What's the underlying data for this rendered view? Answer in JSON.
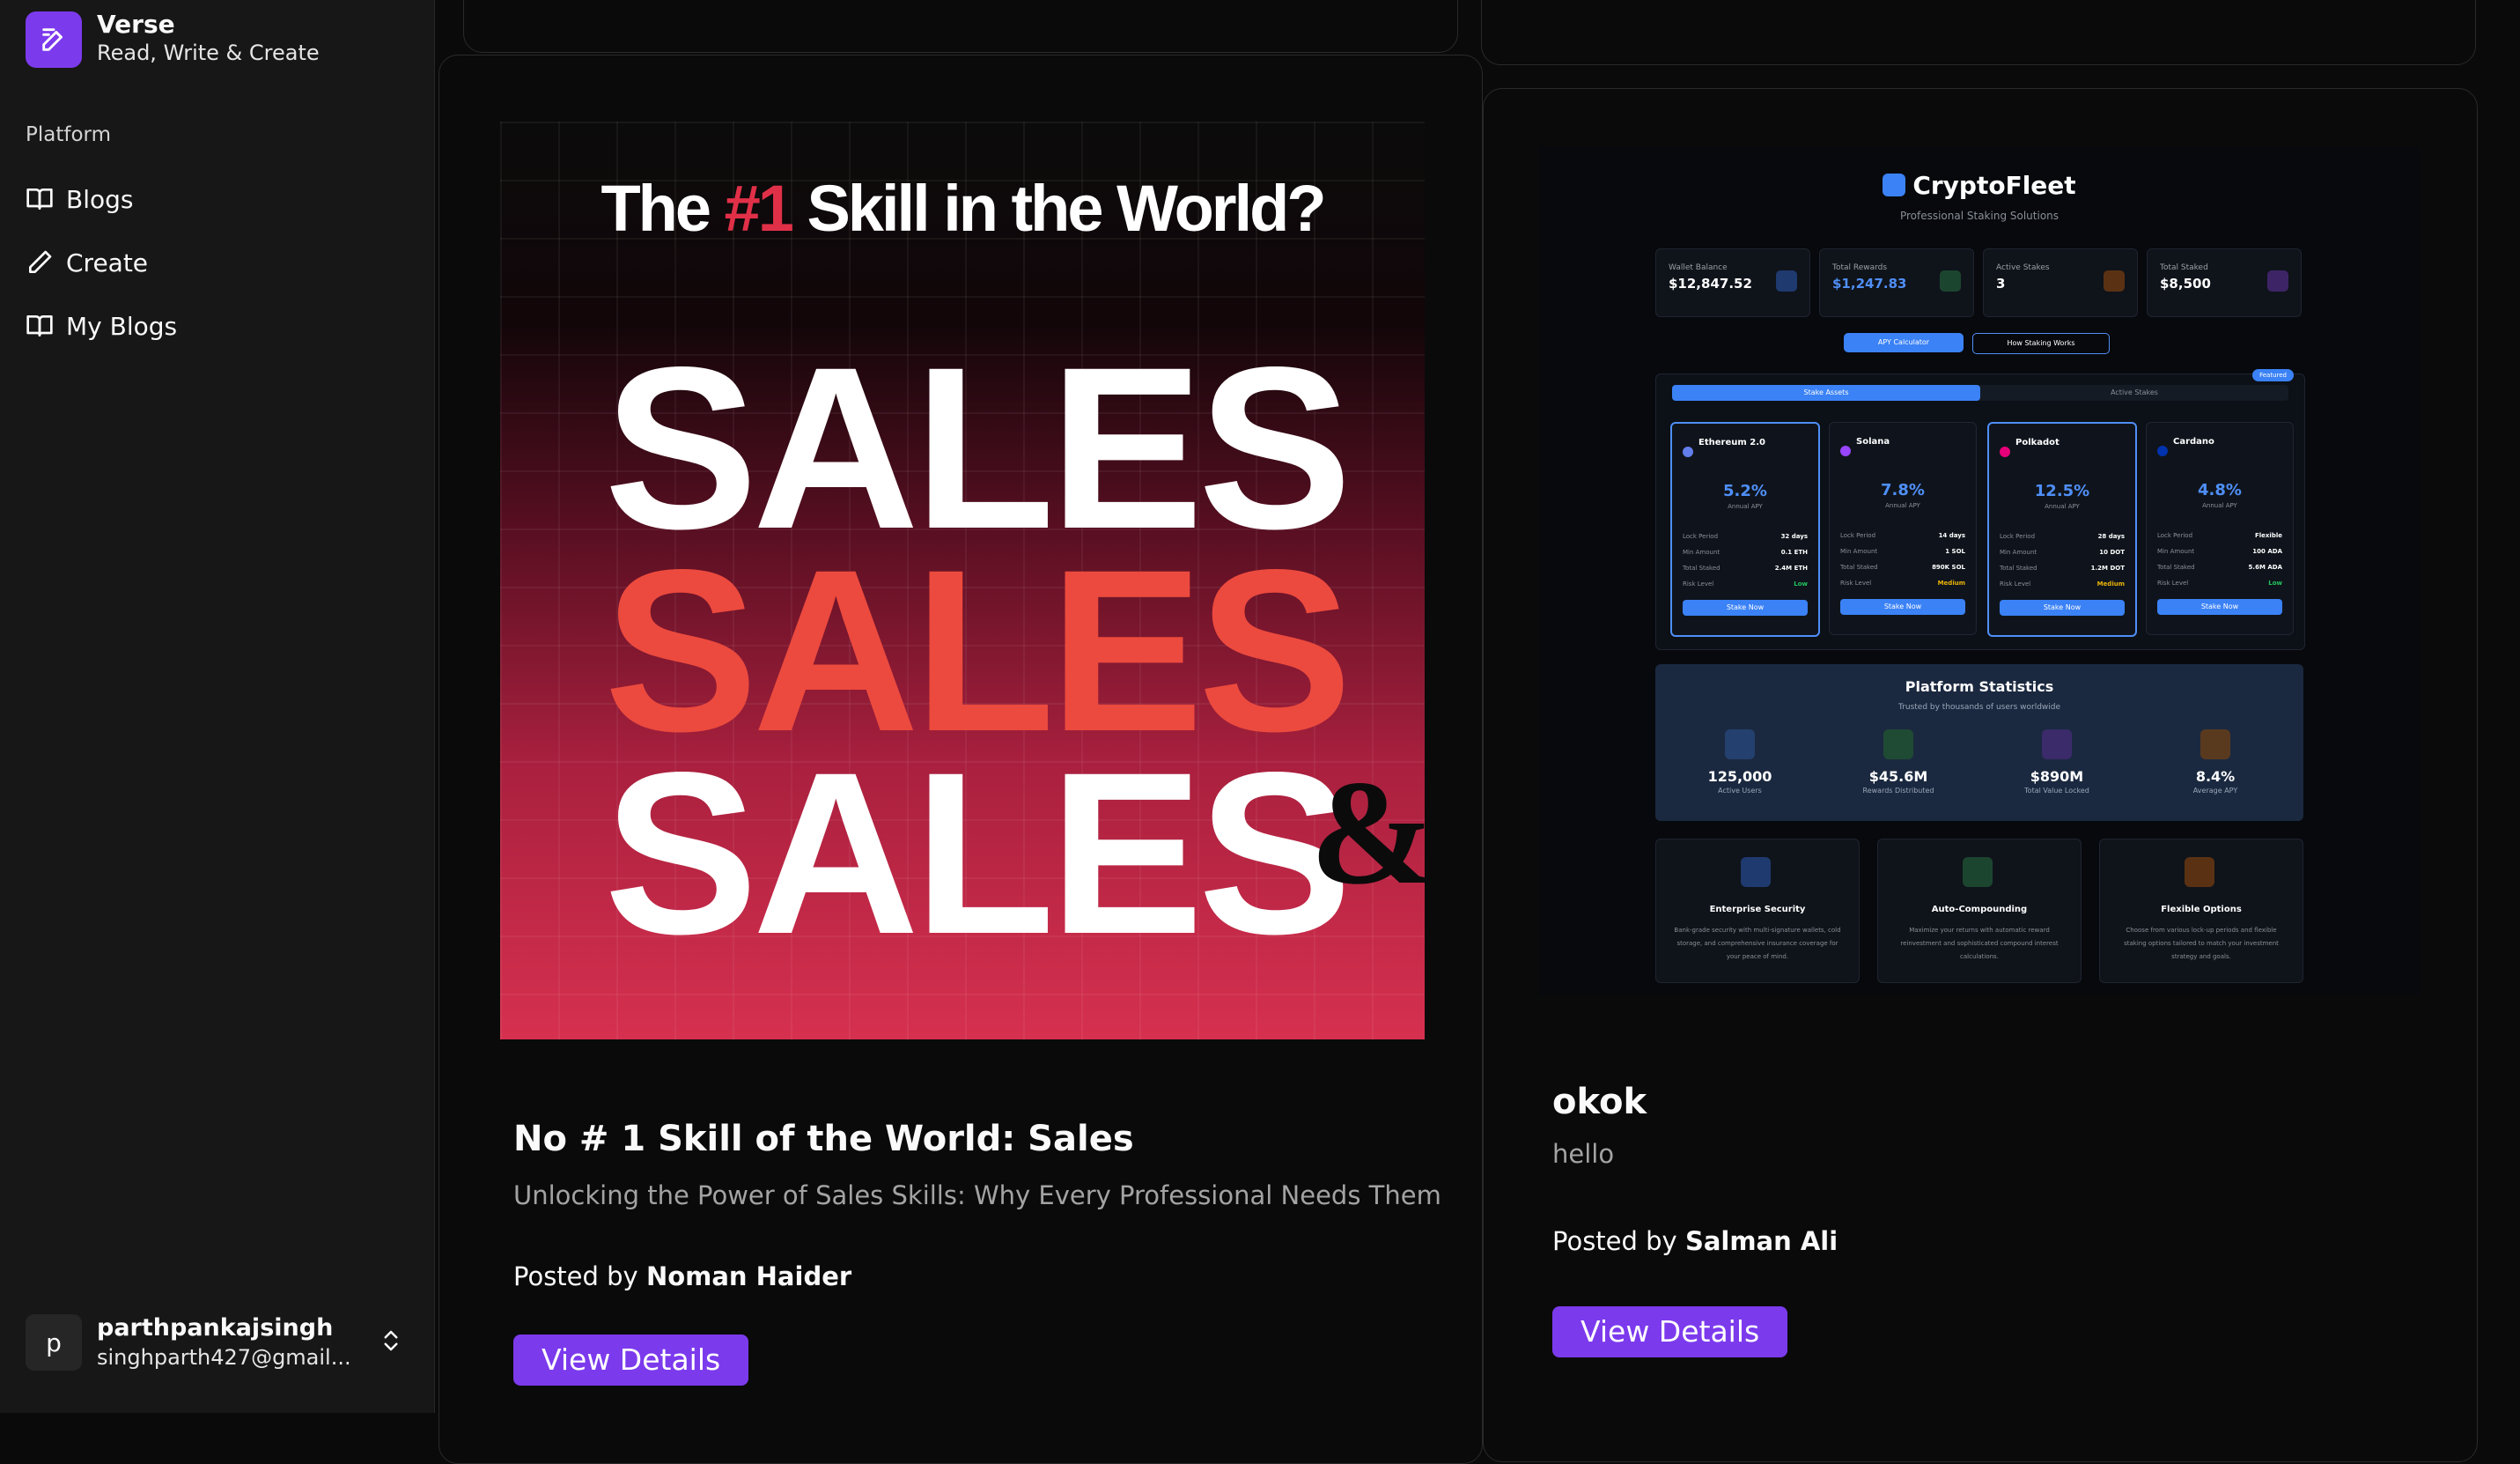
{
  "brand": {
    "name": "Verse",
    "tagline": "Read, Write & Create",
    "accent": "#7c3aed"
  },
  "sidebar": {
    "section_label": "Platform",
    "items": [
      {
        "label": "Blogs",
        "icon": "book-icon"
      },
      {
        "label": "Create",
        "icon": "pencil-icon"
      },
      {
        "label": "My Blogs",
        "icon": "book-icon"
      }
    ]
  },
  "user": {
    "initial": "p",
    "name": "parthpankajsingh",
    "email": "singhparth427@gmail...."
  },
  "posts": [
    {
      "title": "No # 1 Skill of the World: Sales",
      "description": "Unlocking the Power of Sales Skills: Why Every Professional Needs Them",
      "posted_by_prefix": "Posted by",
      "author": "Noman Haider",
      "button": "View Details",
      "image": {
        "headline_pre": "The",
        "headline_hl": "#1",
        "headline_post": "Skill in the World?",
        "words": [
          "SALES",
          "SALES",
          "SALES"
        ],
        "amp": "&"
      }
    },
    {
      "title": "okok",
      "description": "hello",
      "posted_by_prefix": "Posted by",
      "author": "Salman Ali",
      "button": "View Details",
      "image": {
        "brand": "CryptoFleet",
        "subtitle": "Professional Staking Solutions",
        "stats": [
          {
            "label": "Wallet Balance",
            "value": "$12,847.52"
          },
          {
            "label": "Total Rewards",
            "value": "$1,247.83"
          },
          {
            "label": "Active Stakes",
            "value": "3"
          },
          {
            "label": "Total Staked",
            "value": "$8,500"
          }
        ],
        "buttons": [
          "APY Calculator",
          "How Staking Works"
        ],
        "tabs": [
          "Stake Assets",
          "Active Stakes"
        ],
        "featured": "Featured",
        "assets": [
          {
            "name": "Ethereum 2.0",
            "apy": "5.2%",
            "lock": "32 days",
            "min": "0.1 ETH",
            "staked": "2.4M ETH",
            "risk": "Low"
          },
          {
            "name": "Solana",
            "apy": "7.8%",
            "lock": "14 days",
            "min": "1 SOL",
            "staked": "890K SOL",
            "risk": "Medium"
          },
          {
            "name": "Polkadot",
            "apy": "12.5%",
            "lock": "28 days",
            "min": "10 DOT",
            "staked": "1.2M DOT",
            "risk": "Medium"
          },
          {
            "name": "Cardano",
            "apy": "4.8%",
            "lock": "Flexible",
            "min": "100 ADA",
            "staked": "5.6M ADA",
            "risk": "Low"
          }
        ],
        "asset_labels": {
          "apy": "Annual APY",
          "lock": "Lock Period",
          "min": "Min Amount",
          "staked": "Total Staked",
          "risk": "Risk Level",
          "button": "Stake Now"
        },
        "platform": {
          "title": "Platform Statistics",
          "subtitle": "Trusted by thousands of users worldwide",
          "metrics": [
            {
              "value": "125,000",
              "label": "Active Users"
            },
            {
              "value": "$45.6M",
              "label": "Rewards Distributed"
            },
            {
              "value": "$890M",
              "label": "Total Value Locked"
            },
            {
              "value": "8.4%",
              "label": "Average APY"
            }
          ]
        },
        "features": [
          {
            "title": "Enterprise Security",
            "desc": "Bank-grade security with multi-signature wallets, cold storage, and comprehensive insurance coverage for your peace of mind."
          },
          {
            "title": "Auto-Compounding",
            "desc": "Maximize your returns with automatic reward reinvestment and sophisticated compound interest calculations."
          },
          {
            "title": "Flexible Options",
            "desc": "Choose from various lock-up periods and flexible staking options tailored to match your investment strategy and goals."
          }
        ]
      }
    }
  ]
}
